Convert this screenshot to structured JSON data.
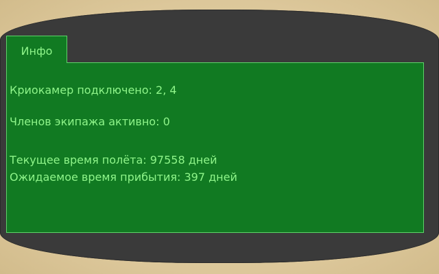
{
  "tabs": [
    {
      "label": "Инфо"
    }
  ],
  "info": {
    "cryo_chambers": "Криокамер подключено: 2, 4",
    "crew_active": "Членов экипажа активно: 0",
    "flight_time": "Текущее время полёта: 97558 дней",
    "arrival_time": "Ожидаемое время прибытия: 397 дней"
  },
  "colors": {
    "panel_bg": "#117a22",
    "panel_border": "#5ed36a",
    "text": "#8ff58a",
    "frame": "#3a3a3a",
    "backdrop": "#e6d2a6"
  }
}
